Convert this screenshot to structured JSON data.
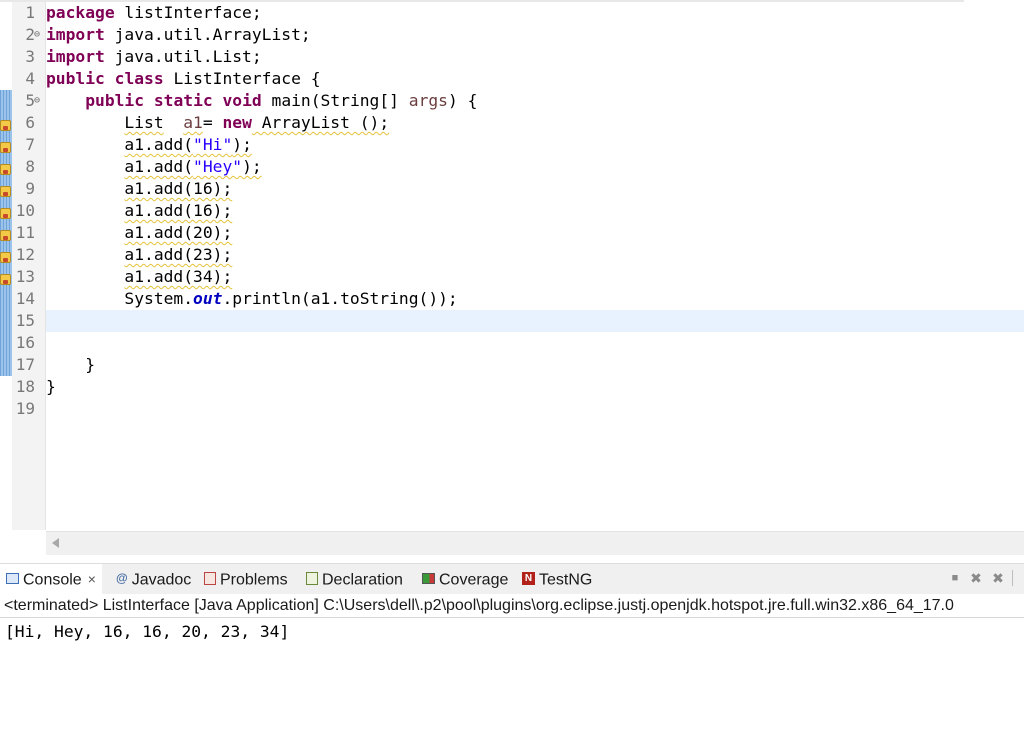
{
  "editor": {
    "lines": [
      {
        "num": "1",
        "fold": ""
      },
      {
        "num": "2",
        "fold": "⊖"
      },
      {
        "num": "3",
        "fold": ""
      },
      {
        "num": "4",
        "fold": ""
      },
      {
        "num": "5",
        "fold": "⊖"
      },
      {
        "num": "6",
        "fold": ""
      },
      {
        "num": "7",
        "fold": ""
      },
      {
        "num": "8",
        "fold": ""
      },
      {
        "num": "9",
        "fold": ""
      },
      {
        "num": "10",
        "fold": ""
      },
      {
        "num": "11",
        "fold": ""
      },
      {
        "num": "12",
        "fold": ""
      },
      {
        "num": "13",
        "fold": ""
      },
      {
        "num": "14",
        "fold": ""
      },
      {
        "num": "15",
        "fold": ""
      },
      {
        "num": "16",
        "fold": ""
      },
      {
        "num": "17",
        "fold": ""
      },
      {
        "num": "18",
        "fold": ""
      },
      {
        "num": "19",
        "fold": ""
      }
    ],
    "code": {
      "l1_kw": "package",
      "l1_rest": " listInterface;",
      "l2_kw": "import",
      "l2_rest": " java.util.ArrayList;",
      "l3_kw": "import",
      "l3_rest": " java.util.List;",
      "l4_kw1": "public",
      "l4_kw2": "class",
      "l4_rest": " ListInterface {",
      "l5_indent": "    ",
      "l5_kw1": "public",
      "l5_kw2": "static",
      "l5_kw3": "void",
      "l5_mid": " main(String[] ",
      "l5_var": "args",
      "l5_end": ") {",
      "l6_indent": "        ",
      "l6_type": "List",
      "l6_sp": "  ",
      "l6_var": "a1",
      "l6_eq": "= ",
      "l6_kw": "new",
      "l6_end": " ArrayList ();",
      "l7_indent": "        ",
      "l7_call": "a1.add(",
      "l7_str": "\"Hi\"",
      "l7_end": ");",
      "l8_indent": "        ",
      "l8_call": "a1.add(",
      "l8_str": "\"Hey\"",
      "l8_end": ");",
      "l9": "        a1.add(16);",
      "l9_indent": "        ",
      "l9_call": "a1.add(16);",
      "l10_indent": "        ",
      "l10_call": "a1.add(16);",
      "l11_indent": "        ",
      "l11_call": "a1.add(20);",
      "l12_indent": "        ",
      "l12_call": "a1.add(23);",
      "l13_indent": "        ",
      "l13_call": "a1.add(34);",
      "l14_indent": "        ",
      "l14_a": "System.",
      "l14_field": "out",
      "l14_b": ".println(a1.toString());",
      "l17": "    }",
      "l18": "}"
    }
  },
  "panel": {
    "tabs": {
      "console": "Console",
      "javadoc": "Javadoc",
      "problems": "Problems",
      "declaration": "Declaration",
      "coverage": "Coverage",
      "testng": "TestNG"
    },
    "close_glyph": "×",
    "status": "<terminated> ListInterface [Java Application] C:\\Users\\dell\\.p2\\pool\\plugins\\org.eclipse.justj.openjdk.hotspot.jre.full.win32.x86_64_17.0",
    "output": "[Hi, Hey, 16, 16, 20, 23, 34]",
    "toolbar": {
      "stop": "■",
      "remove": "✖",
      "remove_all": "✖"
    }
  }
}
